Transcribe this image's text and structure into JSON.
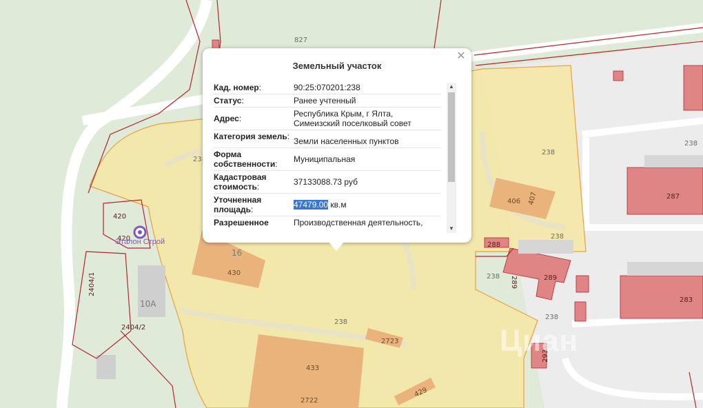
{
  "popup": {
    "title": "Земельный участок",
    "close_icon": "✕",
    "rows": [
      {
        "key": "Кад. номер",
        "value": "90:25:070201:238"
      },
      {
        "key": "Статус",
        "value": "Ранее учтенный"
      },
      {
        "key": "Адрес",
        "value": "Республика Крым, г Ялта, Симеизский поселковый совет"
      },
      {
        "key": "Категория земель",
        "value": "Земли населенных пунктов"
      },
      {
        "key": "Форма собственности",
        "value": "Муниципальная"
      },
      {
        "key": "Кадастровая стоимость",
        "value": "37133088.73 руб"
      },
      {
        "key": "Уточненная площадь",
        "value_highlight": "47479.00",
        "value_suffix": " кв.м"
      },
      {
        "key": "Разрешенное",
        "value": "Производственная деятельность,"
      }
    ]
  },
  "map": {
    "labels": {
      "p827": "827",
      "p238_left": "238",
      "p238_right_mid": "238",
      "p238_bottom_a": "238",
      "p238_bottom_b": "238",
      "p238_right_top": "238",
      "p238_right_low": "238",
      "p238_center": "238",
      "p238_far": "238",
      "p420_a": "420",
      "p420_b": "420",
      "p2404_1": "2404/1",
      "p2404_2": "2404/2",
      "p10A": "10А",
      "p16": "16",
      "p430": "430",
      "p433": "433",
      "p2722": "2722",
      "p2723": "2723",
      "p429": "429",
      "p406": "406",
      "p407": "407",
      "p288": "288",
      "p289": "289",
      "p289_b": "289",
      "p287": "287",
      "p283": "283",
      "p293": "293"
    },
    "poi": {
      "name": "Эталон Строй",
      "icon": "poi-circle-icon"
    },
    "watermark": "Циан",
    "colors": {
      "parcel_fill": "#f7e7a4",
      "parcel_border": "#e8a13c",
      "building": "#eab37c",
      "red_building": "#e08585",
      "boundary": "#b3262c",
      "road": "#ffffff",
      "green": "#dfead8"
    }
  }
}
